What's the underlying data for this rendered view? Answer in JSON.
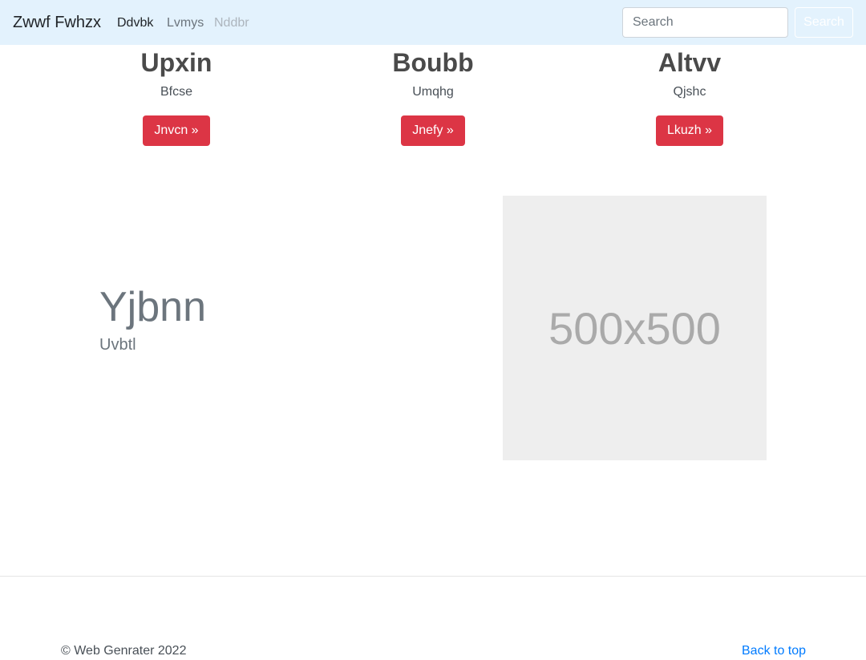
{
  "navbar": {
    "brand": "Zwwf Fwhzx",
    "links": [
      {
        "label": "Ddvbk",
        "state": "active"
      },
      {
        "label": "Lvmys",
        "state": "normal"
      },
      {
        "label": "Nddbr",
        "state": "disabled"
      }
    ],
    "search": {
      "placeholder": "Search",
      "button_label": "Search"
    },
    "background": "#e3f2fd"
  },
  "features": [
    {
      "title": "Upxin",
      "text": "Bfcse",
      "button": "Jnvcn »"
    },
    {
      "title": "Boubb",
      "text": "Umqhg",
      "button": "Jnefy »"
    },
    {
      "title": "Altvv",
      "text": "Qjshc",
      "button": "Lkuzh »"
    }
  ],
  "hero": {
    "title": "Yjbnn",
    "subtitle": "Uvbtl",
    "image_text": "500x500"
  },
  "footer": {
    "copyright": "© Web Genrater 2022",
    "back_to_top": "Back to top"
  },
  "colors": {
    "accent_button": "#dc3545",
    "link": "#007bff",
    "image_placeholder": "#eeeeee"
  }
}
